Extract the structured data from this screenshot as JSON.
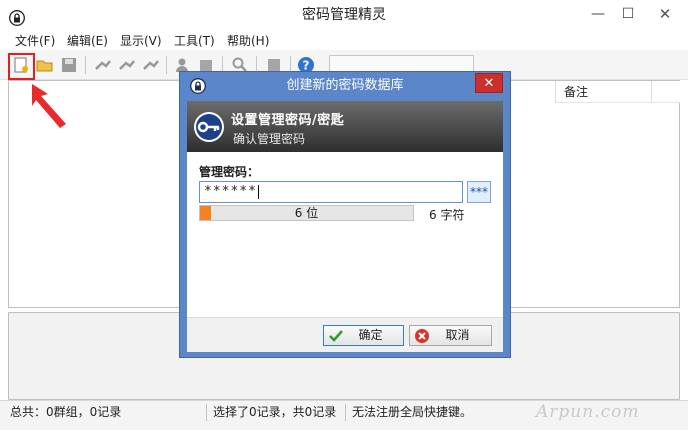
{
  "window": {
    "title": "密码管理精灵",
    "min_glyph": "—",
    "max_glyph": "☐",
    "close_glyph": "✕"
  },
  "menu": [
    "文件(F)",
    "编辑(E)",
    "显示(V)",
    "工具(T)",
    "帮助(H)"
  ],
  "toolbar": {
    "icons": [
      "new-database-icon",
      "open-folder-icon",
      "save-icon",
      "add-entry-icon",
      "edit-entry-icon",
      "delete-entry-icon",
      "user-icon",
      "document-icon",
      "search-icon",
      "lock-icon",
      "help-icon"
    ],
    "combo_value": ""
  },
  "grid": {
    "columns": [
      "备注"
    ]
  },
  "status": {
    "summary": "总共：0群组，0记录",
    "selection": "选择了0记录，共0记录",
    "hotkey": "无法注册全局快捷键。"
  },
  "dialog": {
    "title": "创建新的密码数据库",
    "close_glyph": "✕",
    "banner_title": "设置管理密码/密匙",
    "banner_subtitle": "确认管理密码",
    "password_label": "管理密码：",
    "password_value": "******",
    "mask_toggle": "***",
    "quality_fraction": 0.05,
    "quality_text": "6 位",
    "char_count": "6 字符",
    "ok_label": "确定",
    "cancel_label": "取消"
  },
  "watermark": "Arpun.com",
  "colors": {
    "accent_red": "#e02020",
    "dialog_frame": "#5b86c9",
    "quality_fill": "#f58220",
    "close_red": "#c9302c"
  }
}
